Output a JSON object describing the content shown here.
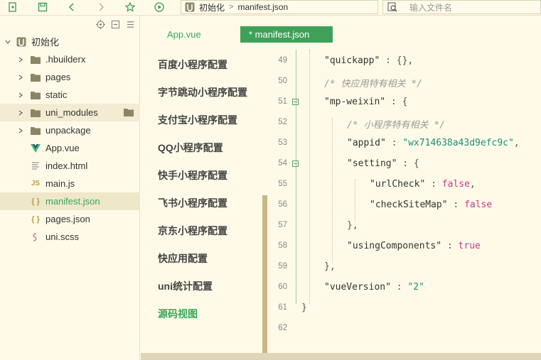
{
  "toolbar": {
    "icons": [
      "new-file-icon",
      "save-icon",
      "back-icon",
      "forward-icon",
      "star-icon",
      "run-icon"
    ],
    "breadcrumb": {
      "project": "初始化",
      "file": "manifest.json"
    },
    "search_placeholder": "输入文件名"
  },
  "sidebar": {
    "project": "初始化",
    "items": [
      {
        "label": ".hbuilderx",
        "type": "folder"
      },
      {
        "label": "pages",
        "type": "folder"
      },
      {
        "label": "static",
        "type": "folder"
      },
      {
        "label": "uni_modules",
        "type": "folder"
      },
      {
        "label": "unpackage",
        "type": "folder"
      },
      {
        "label": "App.vue",
        "type": "vue"
      },
      {
        "label": "index.html",
        "type": "html"
      },
      {
        "label": "main.js",
        "type": "js"
      },
      {
        "label": "manifest.json",
        "type": "json"
      },
      {
        "label": "pages.json",
        "type": "json"
      },
      {
        "label": "uni.scss",
        "type": "scss"
      }
    ]
  },
  "tabs": [
    {
      "label": "App.vue"
    },
    {
      "label": "* manifest.json"
    }
  ],
  "config_menu": [
    "百度小程序配置",
    "字节跳动小程序配置",
    "支付宝小程序配置",
    "QQ小程序配置",
    "快手小程序配置",
    "飞书小程序配置",
    "京东小程序配置",
    "快应用配置",
    "uni统计配置",
    "源码视图"
  ],
  "code": {
    "line_numbers": [
      "49",
      "50",
      "51",
      "52",
      "53",
      "54",
      "55",
      "56",
      "57",
      "58",
      "59",
      "60",
      "61",
      "62"
    ],
    "l49": {
      "key": "\"quickapp\"",
      "rest": " : {},"
    },
    "l50": "/* 快应用特有相关 */",
    "l51": {
      "key": "\"mp-weixin\"",
      "rest": " : {"
    },
    "l52": "/* 小程序特有相关 */",
    "l53": {
      "key": "\"appid\"",
      "sep": " : ",
      "value": "\"wx714638a43d9efc9c\"",
      "end": ","
    },
    "l54": {
      "key": "\"setting\"",
      "rest": " : {"
    },
    "l55": {
      "key": "\"urlCheck\"",
      "sep": " : ",
      "value": "false",
      "end": ","
    },
    "l56": {
      "key": "\"checkSiteMap\"",
      "sep": " : ",
      "value": "false"
    },
    "l57": "},",
    "l58": {
      "key": "\"usingComponents\"",
      "sep": " : ",
      "value": "true"
    },
    "l59": "},",
    "l60": {
      "key": "\"vueVersion\"",
      "sep": " : ",
      "value": "\"2\""
    },
    "l61": "}"
  },
  "colors": {
    "accent": "#3ea15a",
    "background": "#fffae8",
    "string": "#1c8f7a",
    "boolean": "#c23b8a"
  }
}
